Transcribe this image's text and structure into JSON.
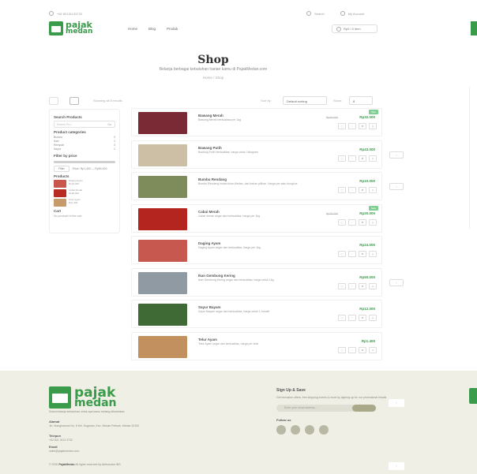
{
  "topbar": {
    "phone": "+62 82131133732",
    "search_label": "Search",
    "account_label": "My Account"
  },
  "brand": {
    "line1": "pajak",
    "line2": "medan"
  },
  "nav": {
    "items": [
      "Home",
      "Blog",
      "Produk"
    ]
  },
  "cart": {
    "label": "Rp0 / 0 item"
  },
  "header": {
    "title": "Shop",
    "subtitle": "Belanja berbagai kebutuhan harian kamu di PajakMedan.com",
    "breadcrumb": "Home  /  Shop"
  },
  "toolbar": {
    "result_count": "Showing all 8 results",
    "sort_label": "Sort by:",
    "sort_value": "Default sorting",
    "show_label": "Show:",
    "show_value": "8"
  },
  "sidebar": {
    "search_heading": "Search Products",
    "search_placeholder": "Search Pro...",
    "search_button": "Go",
    "categories_heading": "Product categories",
    "categories": [
      {
        "name": "Bumbu",
        "count": "3"
      },
      {
        "name": "Ikan",
        "count": "1"
      },
      {
        "name": "Rempah",
        "count": "3"
      },
      {
        "name": "Sayur",
        "count": "1"
      }
    ],
    "filter_heading": "Filter by price",
    "filter_button": "Filter",
    "price_label": "Price: Rp1,400 — Rp50,000",
    "products_heading": "Products",
    "mini_products": [
      {
        "name": "Daging Ayam",
        "price": "Rp24.000",
        "color": "#c9564e"
      },
      {
        "name": "Cabai Merah",
        "price": "Rp20.000",
        "color": "#b82b23"
      },
      {
        "name": "Telur Ayam",
        "price": "Rp1.400",
        "color": "#c79a6c"
      }
    ],
    "cart_heading": "Cart",
    "cart_empty": "No products in the cart."
  },
  "products": [
    {
      "name": "Bawang Merah",
      "desc": "Bawang Merah berkualitas per 1kg",
      "old_price": "Rp40.000",
      "price": "Rp32.000",
      "badge": "Sale",
      "color": "#7a2a35"
    },
    {
      "name": "Bawang Putih",
      "desc": "Bawang Putih berkualitas, harga untuk 1kilogram",
      "old_price": "",
      "price": "Rp43.000",
      "badge": "",
      "color": "#cdbfa6"
    },
    {
      "name": "Bumbu Rendang",
      "desc": "Bumbu Rendang instan khas Medan, dari bahan pilihan. Harga per satu bungkus",
      "old_price": "",
      "price": "Rp10.000",
      "badge": "",
      "color": "#7e8b5a"
    },
    {
      "name": "Cabai Merah",
      "desc": "Cabai merah segar dan berkualitas, harga per 1kg",
      "old_price": "Rp25.000",
      "price": "Rp20.000",
      "badge": "Sale",
      "color": "#b3251e"
    },
    {
      "name": "Daging Ayam",
      "desc": "Daging Ayam segar dan berkualitas, harga per 1kg",
      "old_price": "",
      "price": "Rp24.000",
      "badge": "",
      "color": "#c6584f"
    },
    {
      "name": "Ikan Gembung Kering",
      "desc": "Ikan Gembung Kering segar dan berkualitas, harga untuk 1kg",
      "old_price": "",
      "price": "Rp50.000",
      "badge": "",
      "color": "#8f9aa3"
    },
    {
      "name": "Sayur Bayam",
      "desc": "Sayur Bayam segar dan berkualitas, harga untuk 1 bundel",
      "old_price": "",
      "price": "Rp12.000",
      "badge": "",
      "color": "#3f6a35"
    },
    {
      "name": "Telur Ayam",
      "desc": "Telur Ayam segar dan berkualitas, harga per butir",
      "old_price": "",
      "price": "Rp1.400",
      "badge": "",
      "color": "#c2905e"
    }
  ],
  "footer": {
    "tagline": "Solusi belanja kebutuhan untuk apa kamu sedang dibutuhkan",
    "address_heading": "Alamat",
    "address": "Jln. Mangkubumi No. 8 Kel. Sugianto, Kec. Medan Petisah, Medan 20152",
    "phone_heading": "Telepon",
    "phone": "+62 821 3113 3732",
    "email_heading": "Email",
    "email": "sales@pajakmedan.com",
    "copyright_prefix": "© 2020",
    "copyright_brand": "PajakMedan",
    "copyright_suffix": "All rights reserved by Atribusolve IBS",
    "signup_heading": "Sign Up & Save",
    "signup_desc": "Get exclusive offers, free shipping events & more by signing up for our promotional emails",
    "email_placeholder": "Enter your email address...",
    "follow_heading": "Follow us"
  }
}
